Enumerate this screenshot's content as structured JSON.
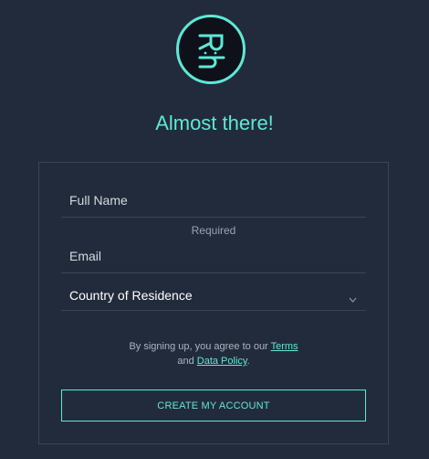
{
  "logo": {
    "icon": "rh-logo-icon",
    "text": "R:h",
    "accent_color": "#5ee8d6"
  },
  "heading": "Almost there!",
  "form": {
    "full_name_placeholder": "Full Name",
    "full_name_value": "",
    "required_text": "Required",
    "email_placeholder": "Email",
    "email_value": "",
    "country_label": "Country of Residence",
    "country_icon": "chevron-down-icon"
  },
  "terms": {
    "prefix": "By signing up, you agree to our ",
    "terms_link": "Terms",
    "middle": "and ",
    "data_policy_link": "Data Policy",
    "suffix": "."
  },
  "cta_label": "CREATE MY ACCOUNT",
  "colors": {
    "background": "#222b3c",
    "accent": "#5ee8d6",
    "card_border": "#3a4455"
  }
}
